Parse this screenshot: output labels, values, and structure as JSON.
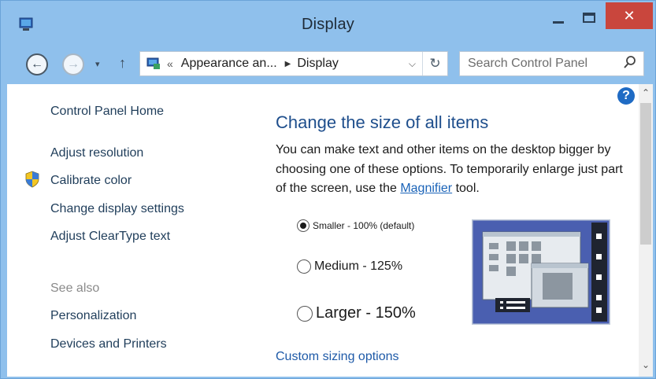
{
  "window": {
    "title": "Display",
    "close_glyph": "✕"
  },
  "nav": {
    "back_glyph": "←",
    "forward_glyph": "→",
    "recent_glyph": "▾",
    "up_glyph": "↑"
  },
  "address": {
    "chevron": "«",
    "segment1": "Appearance an...",
    "separator": "▶",
    "segment2": "Display",
    "dropdown_glyph": "⌵",
    "refresh_glyph": "↻"
  },
  "search": {
    "placeholder": "Search Control Panel",
    "icon_glyph": "⚲"
  },
  "left_nav": {
    "home": "Control Panel Home",
    "items": [
      "Adjust resolution",
      "Calibrate color",
      "Change display settings",
      "Adjust ClearType text"
    ],
    "see_also_label": "See also",
    "see_also_items": [
      "Personalization",
      "Devices and Printers"
    ]
  },
  "main": {
    "heading": "Change the size of all items",
    "description_before": "You can make text and other items on the desktop bigger by choosing one of these options. To temporarily enlarge just part of the screen, use the ",
    "magnifier_link": "Magnifier",
    "description_after": " tool.",
    "options": [
      {
        "label": "Smaller - 100% (default)",
        "checked": true
      },
      {
        "label": "Medium - 125%",
        "checked": false
      },
      {
        "label": "Larger - 150%",
        "checked": false
      }
    ],
    "custom_link": "Custom sizing options"
  },
  "help_glyph": "?",
  "scroll": {
    "up": "⌃",
    "down": "⌄"
  },
  "colors": {
    "titlebar": "#8fc0ec",
    "close": "#c9463d",
    "link": "#1e5aa8",
    "heading": "#1e4e8c",
    "preview_frame": "#4a5fb0"
  }
}
